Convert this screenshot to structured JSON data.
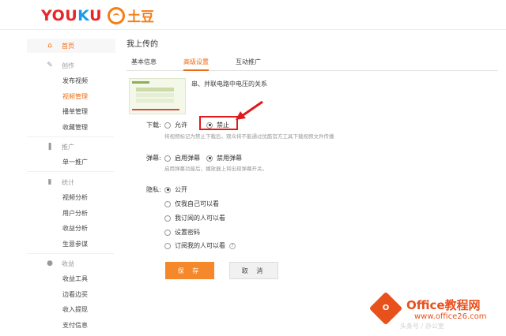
{
  "brand": {
    "youku_logo": "YOUKU",
    "tudou_logo": "土豆"
  },
  "sidebar": {
    "home": {
      "label": "首页",
      "icon": "home-icon"
    },
    "create": {
      "label": "创作",
      "icon": "pencil-icon"
    },
    "create_items": [
      "发布视频",
      "视频管理",
      "播单管理",
      "收藏管理"
    ],
    "promote": {
      "label": "推广",
      "icon": "megaphone-icon"
    },
    "promote_items": [
      "单一推广"
    ],
    "stats": {
      "label": "统计",
      "icon": "bar-chart-icon"
    },
    "stats_items": [
      "视频分析",
      "用户分析",
      "收益分析",
      "生意参谋"
    ],
    "income": {
      "label": "收益",
      "icon": "coin-icon"
    },
    "income_items": [
      "收益工具",
      "边看边买",
      "收入提现",
      "支付信息"
    ]
  },
  "main": {
    "page_title": "我上传的",
    "tabs": [
      "基本信息",
      "高级设置",
      "互动推广"
    ],
    "active_tab": "高级设置",
    "video_title": "串、并联电路中电压的关系"
  },
  "download": {
    "label": "下载:",
    "options": [
      "允许",
      "禁止"
    ],
    "selected": "禁止",
    "hint": "将视频标记为禁止下载后，观众将不能通过优酷官方工具下载视频文件传播"
  },
  "danmaku": {
    "label": "弹幕:",
    "options": [
      "启用弹幕",
      "禁用弹幕"
    ],
    "selected": "禁用弹幕",
    "hint": "启用弹幕功能后，播放器上将出现弹幕开关。"
  },
  "privacy": {
    "label": "隐私:",
    "options": [
      "公开",
      "仅我自己可以看",
      "我订阅的人可以看",
      "设置密码",
      "订阅我的人可以看"
    ],
    "selected": "公开"
  },
  "buttons": {
    "save": "保 存",
    "cancel": "取 消"
  },
  "watermark": {
    "title": "Office教程网",
    "url": "www.office26.com",
    "credit": "头条号 / 办公室"
  },
  "colors": {
    "accent": "#f26b12",
    "save_button": "#f5882a",
    "annotation_red": "#e0191b"
  }
}
